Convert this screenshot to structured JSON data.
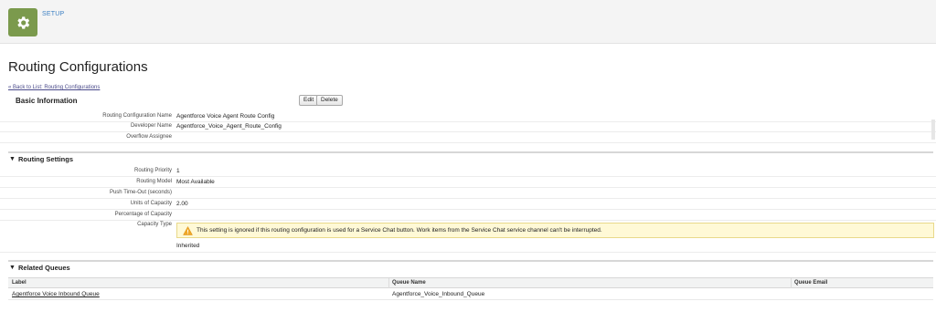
{
  "header": {
    "setup_label": "SETUP",
    "icon": "gear-icon",
    "icon_color": "#7b9a4d"
  },
  "page": {
    "title": "Routing Configurations",
    "back_link": "« Back to List: Routing Configurations"
  },
  "basic_info": {
    "heading": "Basic Information",
    "edit_label": "Edit",
    "delete_label": "Delete",
    "fields": [
      {
        "label": "Routing Configuration Name",
        "value": "Agentforce Voice Agent Route Config"
      },
      {
        "label": "Developer Name",
        "value": "Agentforce_Voice_Agent_Route_Config"
      },
      {
        "label": "Overflow Assignee",
        "value": ""
      }
    ]
  },
  "routing_settings": {
    "heading": "Routing Settings",
    "fields": [
      {
        "label": "Routing Priority",
        "value": "1"
      },
      {
        "label": "Routing Model",
        "value": "Most Available"
      },
      {
        "label": "Push Time-Out (seconds)",
        "value": ""
      },
      {
        "label": "Units of Capacity",
        "value": "2.00"
      },
      {
        "label": "Percentage of Capacity",
        "value": ""
      },
      {
        "label": "Capacity Type",
        "value": ""
      }
    ],
    "warning": "This setting is ignored if this routing configuration is used for a Service Chat button. Work items from the Service Chat service channel can't be interrupted.",
    "warning_icon": "warning-icon",
    "capacity_type_value": "Inherited"
  },
  "related_queues": {
    "heading": "Related Queues",
    "columns": [
      "Label",
      "Queue Name",
      "Queue Email"
    ],
    "rows": [
      {
        "label": "Agentforce Voice Inbound Queue",
        "queue_name": "Agentforce_Voice_Inbound_Queue",
        "queue_email": ""
      }
    ]
  }
}
